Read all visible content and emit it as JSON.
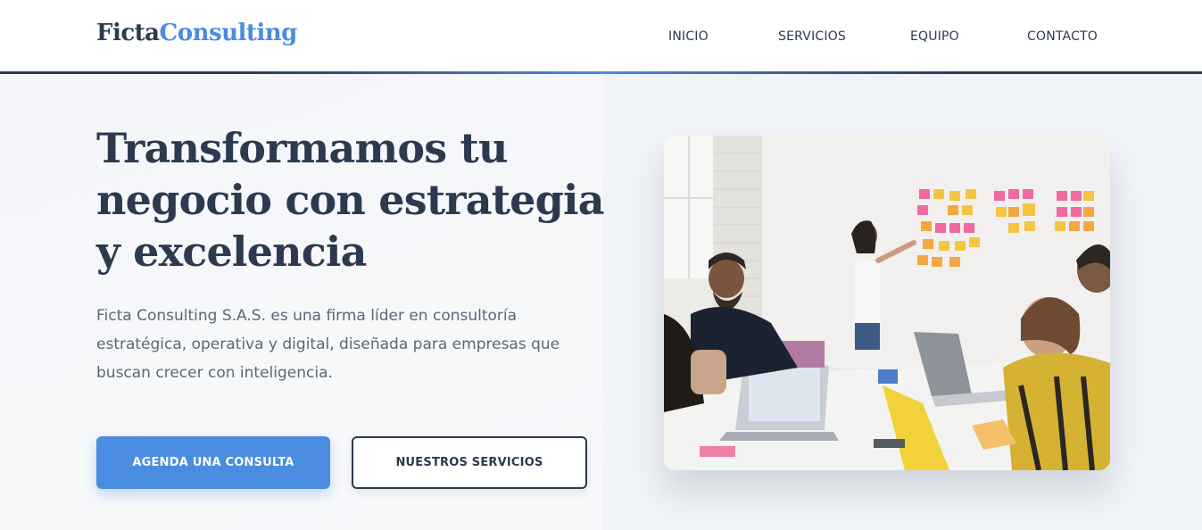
{
  "brand": {
    "part1": "Ficta",
    "part2": "Consulting"
  },
  "nav": [
    {
      "label": "INICIO"
    },
    {
      "label": "SERVICIOS"
    },
    {
      "label": "EQUIPO"
    },
    {
      "label": "CONTACTO"
    }
  ],
  "hero": {
    "title_line1": "Transformamos tu",
    "title_line2": "negocio con estrategia",
    "title_line3": "y excelencia",
    "subtitle_line1": "Ficta Consulting S.A.S. es una firma líder en consultoría",
    "subtitle_line2": "estratégica, operativa y digital, diseñada para empresas que",
    "subtitle_line3": "buscan crecer con inteligencia.",
    "primary_button": "AGENDA UNA CONSULTA",
    "secondary_button": "NUESTROS SERVICIOS"
  },
  "colors": {
    "primary": "#2c3a50",
    "accent": "#4a8ce0",
    "text_muted": "#5b6778",
    "background": "#f4f6f9"
  }
}
